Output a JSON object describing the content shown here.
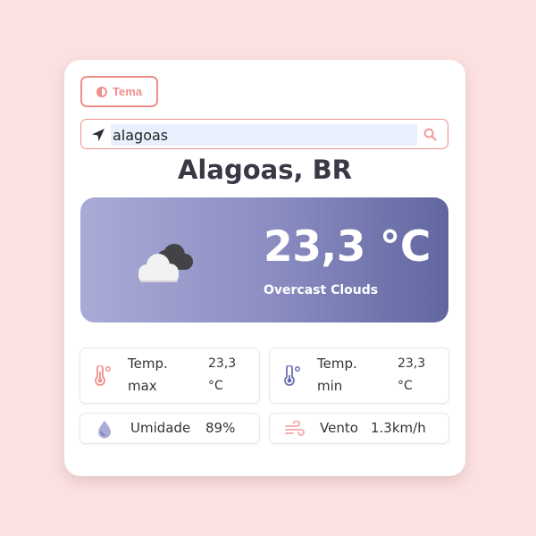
{
  "theme_button": {
    "label": "Tema",
    "icon": "contrast-icon"
  },
  "search": {
    "value": "alagoas",
    "location_icon": "location-arrow-icon",
    "search_icon": "search-icon"
  },
  "location": {
    "city": "Alagoas, BR"
  },
  "current": {
    "temperature": "23,3 °C",
    "description": "Overcast Clouds",
    "icon": "overcast-clouds-icon"
  },
  "details": {
    "temp_max": {
      "label": "Temp. max",
      "value": "23,3 °C",
      "icon": "thermometer-hot-icon"
    },
    "temp_min": {
      "label": "Temp. min",
      "value": "23,3 °C",
      "icon": "thermometer-cold-icon"
    },
    "humidity": {
      "label": "Umidade",
      "value": "89%",
      "icon": "droplet-icon"
    },
    "wind": {
      "label": "Vento",
      "value": "1.3km/h",
      "icon": "wind-icon"
    }
  },
  "colors": {
    "background": "#fbe1e0",
    "accent": "#ef8f8c",
    "hero_gradient_start": "#a9aad6",
    "hero_gradient_end": "#6266a0",
    "cold": "#6b6fb0"
  }
}
